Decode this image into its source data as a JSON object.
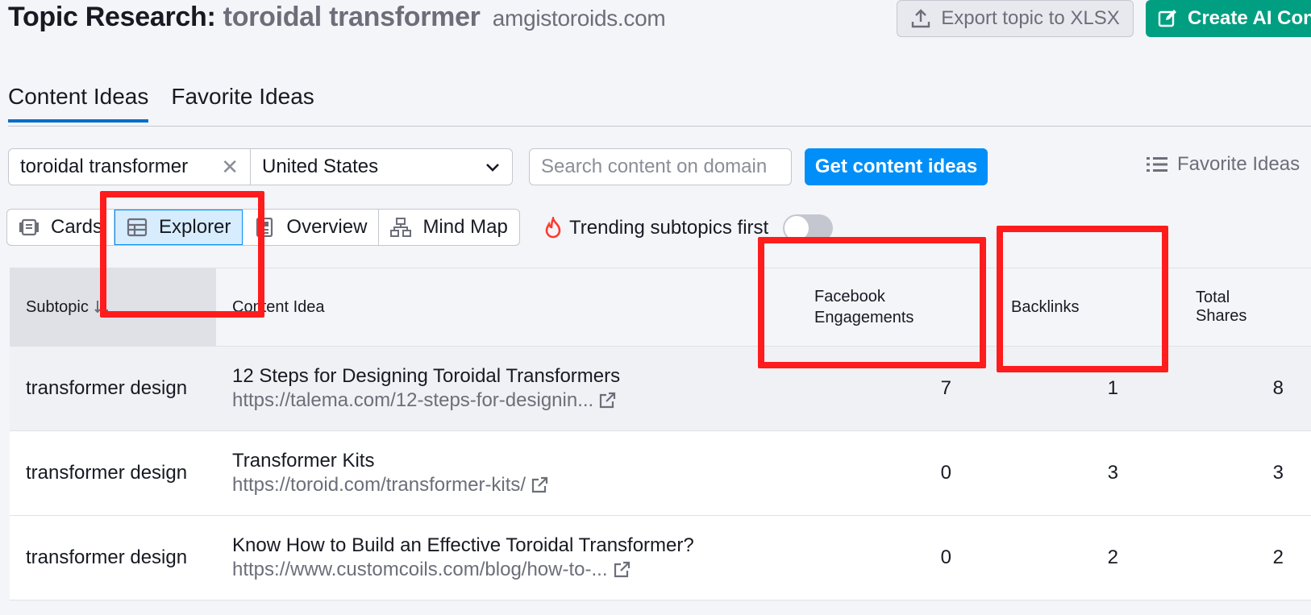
{
  "header": {
    "title_prefix": "Topic Research:",
    "keyword": "toroidal transformer",
    "domain": "amgistoroids.com",
    "export_label": "Export topic to XLSX",
    "create_ai_label": "Create AI Con"
  },
  "tabs": [
    {
      "label": "Content Ideas",
      "active": true
    },
    {
      "label": "Favorite Ideas",
      "active": false
    }
  ],
  "search": {
    "keyword_value": "toroidal transformer",
    "country_value": "United States",
    "domain_placeholder": "Search content on domain",
    "get_ideas_label": "Get content ideas",
    "favorite_ideas_label": "Favorite Ideas"
  },
  "views": [
    {
      "label": "Cards",
      "icon": "cards-icon",
      "active": false
    },
    {
      "label": "Explorer",
      "icon": "table-icon",
      "active": true
    },
    {
      "label": "Overview",
      "icon": "overview-icon",
      "active": false
    },
    {
      "label": "Mind Map",
      "icon": "mindmap-icon",
      "active": false
    }
  ],
  "trending": {
    "label": "Trending subtopics first",
    "icon": "flame-icon",
    "enabled": false
  },
  "table": {
    "headers": {
      "subtopic": "Subtopic",
      "content_idea": "Content Idea",
      "facebook_engagements_1": "Facebook",
      "facebook_engagements_2": "Engagements",
      "backlinks": "Backlinks",
      "total_shares": "Total Shares"
    },
    "rows": [
      {
        "subtopic": "transformer design",
        "title": "12 Steps for Designing Toroidal Transformers",
        "url": "https://talema.com/12-steps-for-designin...",
        "facebook": "7",
        "backlinks": "1",
        "shares": "8"
      },
      {
        "subtopic": "transformer design",
        "title": "Transformer Kits",
        "url": "https://toroid.com/transformer-kits/",
        "facebook": "0",
        "backlinks": "3",
        "shares": "3"
      },
      {
        "subtopic": "transformer design",
        "title": "Know How to Build an Effective Toroidal Transformer?",
        "url": "https://www.customcoils.com/blog/how-to-...",
        "facebook": "0",
        "backlinks": "2",
        "shares": "2"
      }
    ]
  },
  "colors": {
    "accent_blue": "#008ff8",
    "ai_green": "#009f81",
    "annotation_red": "#ff1c1c"
  }
}
